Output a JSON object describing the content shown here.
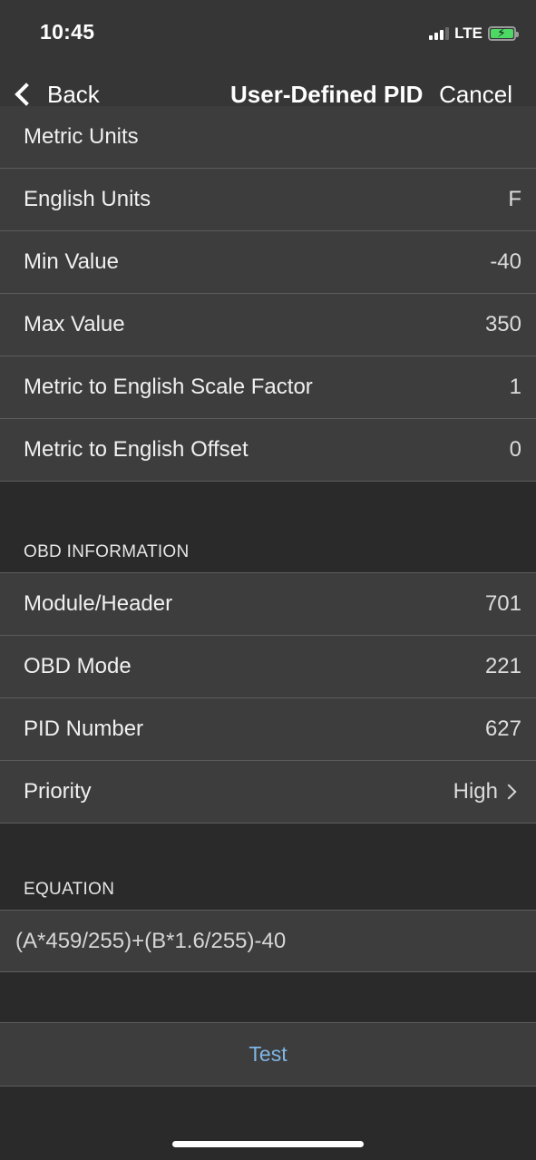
{
  "status_bar": {
    "time": "10:45",
    "network": "LTE",
    "signal_bars_filled": 3,
    "signal_bars_total": 4
  },
  "nav": {
    "back_label": "Back",
    "title": "User-Defined PID",
    "cancel_label": "Cancel"
  },
  "units_rows": [
    {
      "label": "Metric Units",
      "value": ""
    },
    {
      "label": "English Units",
      "value": "F"
    },
    {
      "label": "Min Value",
      "value": "-40"
    },
    {
      "label": "Max Value",
      "value": "350"
    },
    {
      "label": "Metric to English Scale Factor",
      "value": "1"
    },
    {
      "label": "Metric to English Offset",
      "value": "0"
    }
  ],
  "obd_section": {
    "header": "OBD INFORMATION",
    "rows": [
      {
        "label": "Module/Header",
        "value": "701"
      },
      {
        "label": "OBD Mode",
        "value": "221"
      },
      {
        "label": "PID Number",
        "value": "627"
      },
      {
        "label": "Priority",
        "value": "High"
      }
    ]
  },
  "equation_section": {
    "header": "EQUATION",
    "value": "(A*459/255)+(B*1.6/255)-40"
  },
  "test_button": {
    "label": "Test"
  },
  "colors": {
    "accent": "#7fb6e6",
    "background": "#2a2a2a",
    "cell": "#3d3d3d",
    "battery": "#4cd964"
  }
}
